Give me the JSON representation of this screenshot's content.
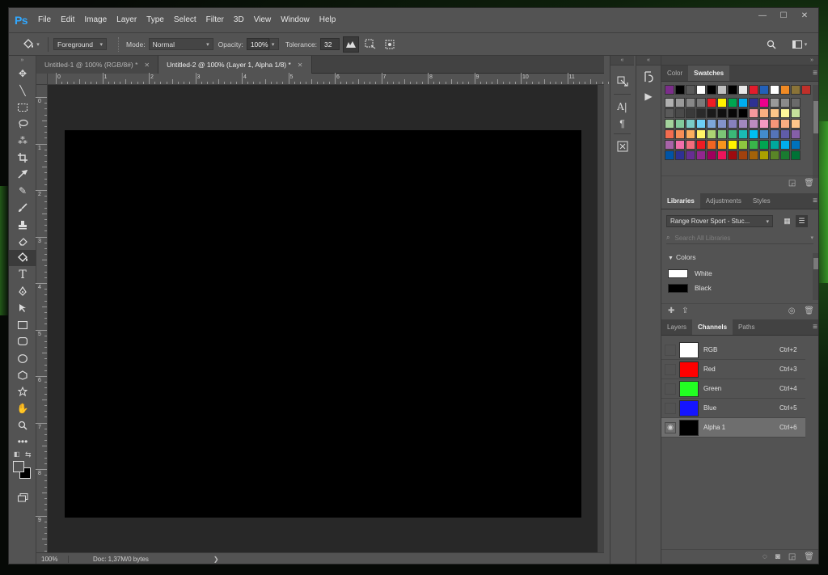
{
  "app": {
    "logo": "Ps",
    "menu": [
      "File",
      "Edit",
      "Image",
      "Layer",
      "Type",
      "Select",
      "Filter",
      "3D",
      "View",
      "Window",
      "Help"
    ]
  },
  "options": {
    "fill_source": "Foreground",
    "mode_label": "Mode:",
    "mode_value": "Normal",
    "opacity_label": "Opacity:",
    "opacity_value": "100%",
    "tolerance_label": "Tolerance:",
    "tolerance_value": "32"
  },
  "tabs": [
    {
      "label": "Untitled-1 @ 100% (RGB/8#) *",
      "active": false
    },
    {
      "label": "Untitled-2 @ 100% (Layer 1, Alpha 1/8) *",
      "active": true
    }
  ],
  "rulers": {
    "top": [
      "0",
      "1",
      "2",
      "3",
      "4",
      "5",
      "6",
      "7",
      "8",
      "9",
      "10",
      "11"
    ],
    "left": [
      "0",
      "1",
      "2",
      "3",
      "4",
      "5",
      "6",
      "7",
      "8",
      "9"
    ]
  },
  "status": {
    "zoom": "100%",
    "doc": "Doc: 1,37M/0 bytes"
  },
  "swatches_panel": {
    "tabs": [
      {
        "label": "Color",
        "active": false
      },
      {
        "label": "Swatches",
        "active": true
      }
    ],
    "colors": [
      [
        "#7b2d8a",
        "#000000",
        "#5a5a5a",
        "#ffffff",
        "#000000",
        "#c0c0c0",
        "#000000",
        "#e8e8e8",
        "#e21c2c",
        "#2360b8",
        "#ffffff",
        "#f08a24",
        "#8a7338",
        "#c0302a"
      ],
      [
        "#b0b0b0",
        "#9a9a9a",
        "#888888",
        "#7a7a7a",
        "#ee1c24",
        "#fff200",
        "#00a651",
        "#00aeef",
        "#2e3192",
        "#ec008c",
        "#9a9a9a",
        "#8a8a8a",
        "#6a6a6a"
      ],
      [
        "#5a5a5a",
        "#4a4a4a",
        "#3a3a3a",
        "#2a2a2a",
        "#1a1a1a",
        "#101010",
        "#080808",
        "#000000",
        "#f5989d",
        "#fbaf81",
        "#fdc689",
        "#fff799",
        "#c4df9b"
      ],
      [
        "#a3d39c",
        "#82ca9c",
        "#7accc8",
        "#6dcff6",
        "#7da7d9",
        "#8393ca",
        "#8781bd",
        "#a187be",
        "#bd8cbf",
        "#f49ac1",
        "#f69679",
        "#f9ad81",
        "#fdc68a"
      ],
      [
        "#f26c4f",
        "#f68e56",
        "#fbaf5d",
        "#fff467",
        "#acd373",
        "#7cc576",
        "#3bb878",
        "#1abbb4",
        "#00bff3",
        "#438ccb",
        "#5574b9",
        "#605ca8",
        "#855fa8"
      ],
      [
        "#a763a8",
        "#f06eaa",
        "#f26d7d",
        "#ed1c24",
        "#f26522",
        "#f7941d",
        "#fff200",
        "#8dc63f",
        "#39b54a",
        "#00a651",
        "#00a99d",
        "#00aeef",
        "#0072bc"
      ],
      [
        "#0054a6",
        "#2e3192",
        "#662d91",
        "#92278f",
        "#9e005d",
        "#ed145b",
        "#9e0b0f",
        "#a0410d",
        "#a36209",
        "#aba000",
        "#598527",
        "#197b30",
        "#007236"
      ]
    ]
  },
  "libraries_panel": {
    "tabs": [
      {
        "label": "Libraries",
        "active": true
      },
      {
        "label": "Adjustments",
        "active": false
      },
      {
        "label": "Styles",
        "active": false
      }
    ],
    "library": "Range Rover Sport - Stuc...",
    "search_placeholder": "Search All Libraries",
    "section": "Colors",
    "colors": [
      {
        "name": "White",
        "color": "#ffffff"
      },
      {
        "name": "Black",
        "color": "#000000"
      }
    ]
  },
  "channels_panel": {
    "tabs": [
      {
        "label": "Layers",
        "active": false
      },
      {
        "label": "Channels",
        "active": true
      },
      {
        "label": "Paths",
        "active": false
      }
    ],
    "channels": [
      {
        "name": "RGB",
        "shortcut": "Ctrl+2",
        "thumb": "#ffffff",
        "visible": false,
        "selected": false
      },
      {
        "name": "Red",
        "shortcut": "Ctrl+3",
        "thumb": "#ff0000",
        "visible": false,
        "selected": false
      },
      {
        "name": "Green",
        "shortcut": "Ctrl+4",
        "thumb": "#22ff22",
        "visible": false,
        "selected": false
      },
      {
        "name": "Blue",
        "shortcut": "Ctrl+5",
        "thumb": "#1414ff",
        "visible": false,
        "selected": false
      },
      {
        "name": "Alpha 1",
        "shortcut": "Ctrl+6",
        "thumb": "#000000",
        "visible": true,
        "selected": true
      }
    ]
  }
}
